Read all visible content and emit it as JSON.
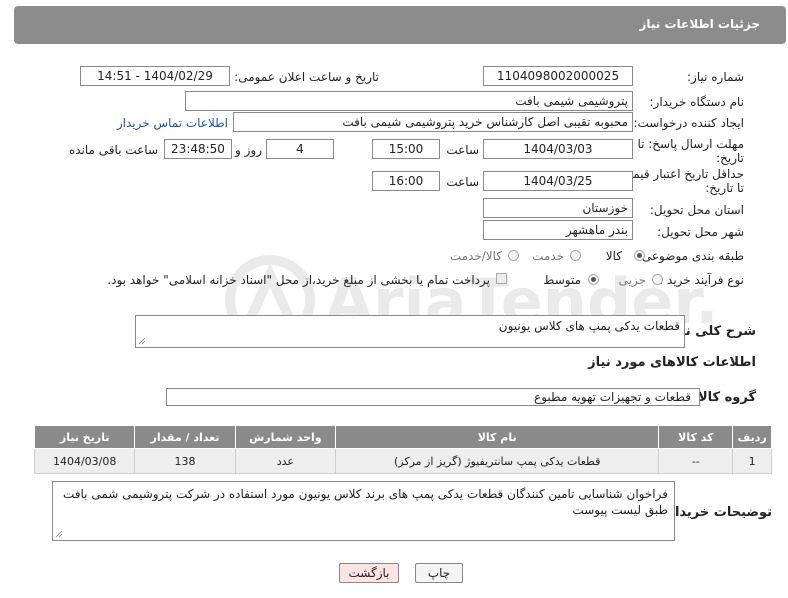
{
  "header": {
    "title": "جزئیات اطلاعات نیاز"
  },
  "fields": {
    "need_number": {
      "label": "شماره نیاز:",
      "value": "1104098002000025"
    },
    "announce_datetime": {
      "label": "تاریخ و ساعت اعلان عمومی:",
      "value": "1404/02/29 - 14:51"
    },
    "buyer_org": {
      "label": "نام دستگاه خریدار:",
      "value": "پتروشیمی شیمی بافت"
    },
    "requester": {
      "label": "ایجاد کننده درخواست:",
      "value": "محبوبه تقیبی اصل کارشناس خرید پتروشیمی شیمی بافت",
      "contact_link": "اطلاعات تماس خریدار"
    },
    "reply_deadline": {
      "label_line1": "مهلت ارسال پاسخ: تا",
      "label_line2": "تاریخ:",
      "date": "1404/03/03",
      "time_label": "ساعت",
      "time": "15:00",
      "days": "4",
      "days_label": "روز و",
      "remaining": "23:48:50",
      "remaining_label": "ساعت باقی مانده"
    },
    "price_validity": {
      "label_line1": "حداقل تاریخ اعتبار قیمت:",
      "label_line2": "تا تاریخ:",
      "date": "1404/03/25",
      "time_label": "ساعت",
      "time": "16:00"
    },
    "delivery_province": {
      "label": "استان محل تحویل:",
      "value": "خوزستان"
    },
    "delivery_city": {
      "label": "شهر محل تحویل:",
      "value": "بندر ماهشهر"
    },
    "category": {
      "label": "طبقه بندی موضوعی:",
      "options": [
        "کالا",
        "خدمت",
        "کالا/خدمت"
      ],
      "selected": "کالا"
    },
    "purchase_type": {
      "label": "نوع فرآیند خرید :",
      "options": [
        "جزیی",
        "متوسط"
      ],
      "selected": "متوسط",
      "note": "پرداخت تمام یا بخشی از مبلغ خرید،از محل \"اسناد خزانه اسلامی\" خواهد بود."
    }
  },
  "description": {
    "label": "شرح کلی نیاز:",
    "value": "قطعات یدکی پمپ های کلاس یونیون"
  },
  "goods_section": {
    "title": "اطلاعات کالاهای مورد نیاز"
  },
  "goods_group": {
    "label": "گروه کالا:",
    "value": "قطعات و تجهیزات تهویه مطبوع"
  },
  "table": {
    "headers": [
      "ردیف",
      "کد کالا",
      "نام کالا",
      "واحد شمارش",
      "تعداد / مقدار",
      "تاریخ نیاز"
    ],
    "rows": [
      [
        "1",
        "--",
        "قطعات یدکی پمپ سانتریفیوژ (گریز از مرکز)",
        "عدد",
        "138",
        "1404/03/08"
      ]
    ]
  },
  "buyer_notes": {
    "label": "توضیحات خریدار:",
    "value": "فراخوان شناسایی تامین کنندگان قطعات یدکی پمپ های برند کلاس یونیون مورد استفاده در شرکت پتروشیمی شمی بافت طبق لیست پیوست"
  },
  "buttons": {
    "print": "چاپ",
    "back": "بازگشت"
  },
  "watermark": {
    "text": "AriaTender.neT"
  },
  "colors": {
    "header_bg": "#8c8c8c",
    "table_header_bg": "#8a8a8a",
    "link": "#1a58a8",
    "back_button_bg": "#fde4e4"
  }
}
